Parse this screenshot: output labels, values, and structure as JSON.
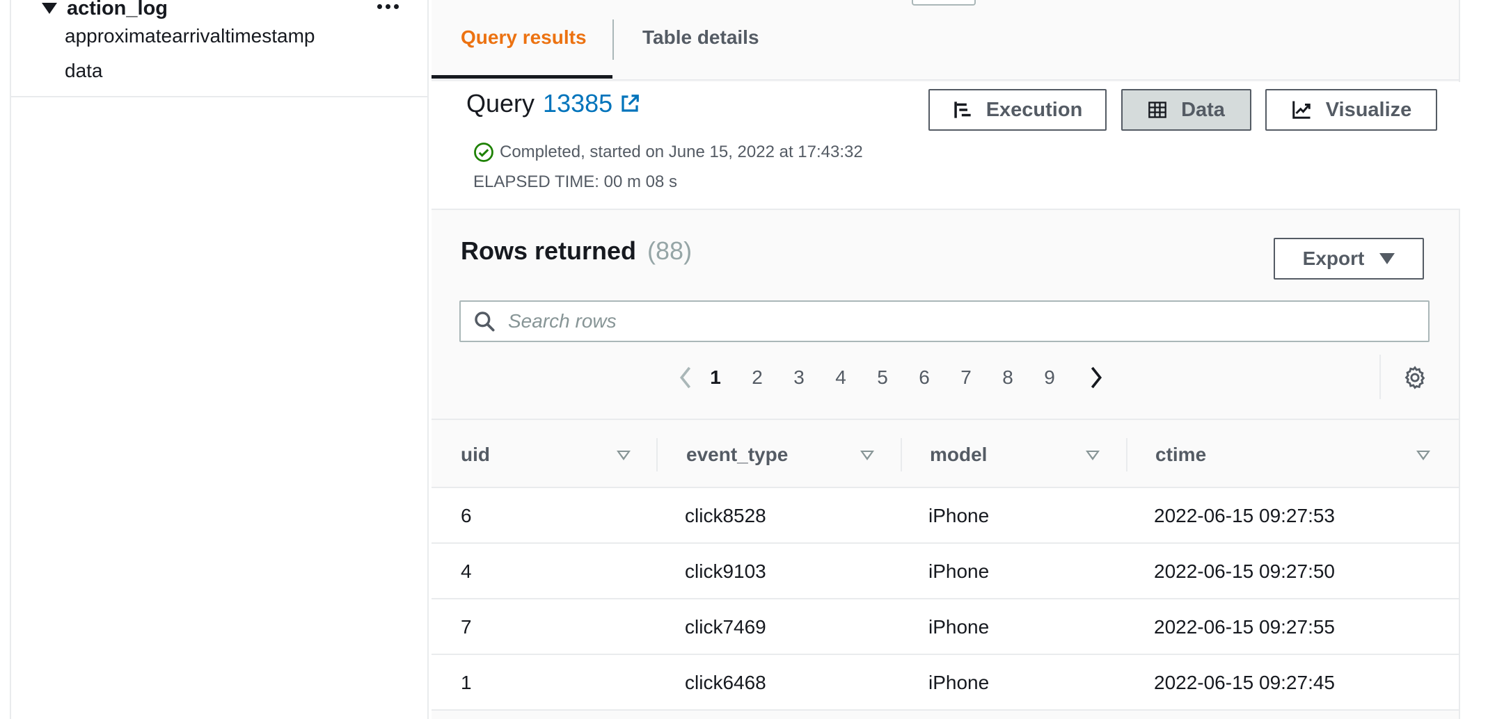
{
  "sidebar": {
    "table_name": "action_log",
    "columns": [
      "approximatearrivaltimestamp",
      "data"
    ]
  },
  "tabs": {
    "query_results": "Query results",
    "table_details": "Table details"
  },
  "query": {
    "label": "Query",
    "id": "13385",
    "status": "Completed, started on June 15, 2022 at 17:43:32",
    "elapsed": "ELAPSED TIME: 00 m 08 s"
  },
  "toolbar": {
    "execution": "Execution",
    "data": "Data",
    "visualize": "Visualize"
  },
  "rows": {
    "title": "Rows returned",
    "count": "(88)",
    "export_label": "Export"
  },
  "search": {
    "placeholder": "Search rows"
  },
  "pagination": {
    "pages": [
      "1",
      "2",
      "3",
      "4",
      "5",
      "6",
      "7",
      "8",
      "9"
    ],
    "current": "1"
  },
  "table": {
    "columns": [
      "uid",
      "event_type",
      "model",
      "ctime"
    ],
    "rows": [
      [
        "6",
        "click8528",
        "iPhone",
        "2022-06-15 09:27:53"
      ],
      [
        "4",
        "click9103",
        "iPhone",
        "2022-06-15 09:27:50"
      ],
      [
        "7",
        "click7469",
        "iPhone",
        "2022-06-15 09:27:55"
      ],
      [
        "1",
        "click6468",
        "iPhone",
        "2022-06-15 09:27:45"
      ]
    ]
  },
  "colors": {
    "accent_orange": "#ec7211",
    "link_blue": "#0073bb",
    "success_green": "#1d8102",
    "text_dark": "#16191f",
    "text_muted": "#545b64"
  },
  "icons": {
    "tree_toggle": "caret-down-icon",
    "more_actions": "ellipsis-icon",
    "external_link": "external-link-icon",
    "status": "check-circle-icon",
    "execution": "gantt-icon",
    "data": "grid-icon",
    "visualize": "line-chart-icon",
    "export": "caret-down-icon",
    "search": "search-icon",
    "prev": "chevron-left-icon",
    "next": "chevron-right-icon",
    "settings": "gear-icon",
    "sort": "sort-icon"
  }
}
